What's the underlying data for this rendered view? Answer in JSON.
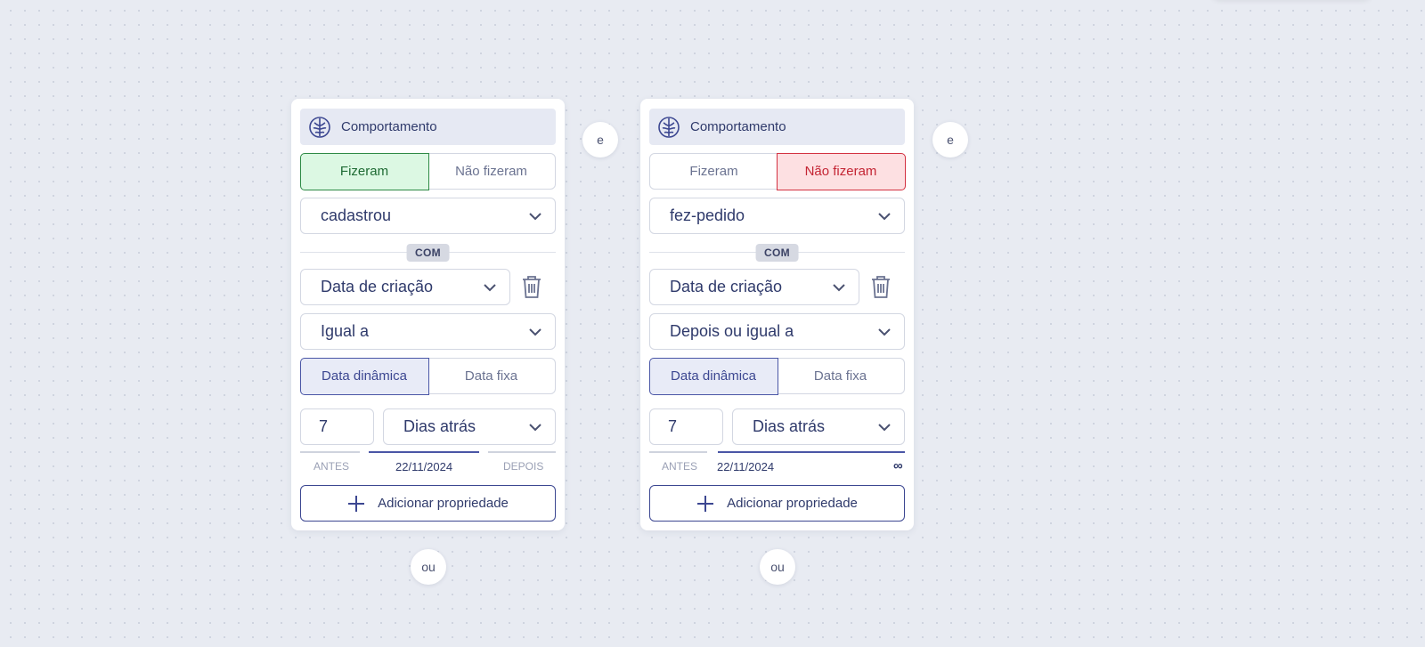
{
  "connectors": {
    "and_label": "e",
    "or_label": "ou"
  },
  "cards": [
    {
      "header_title": "Comportamento",
      "header_icon": "brain-icon",
      "did_options": [
        "Fizeram",
        "Não fizeram"
      ],
      "did_selected": "Fizeram",
      "event": "cadastrou",
      "with_label": "COM",
      "property": "Data de criação",
      "operator": "Igual a",
      "date_mode_options": [
        "Data dinâmica",
        "Data fixa"
      ],
      "date_mode_selected": "Data dinâmica",
      "amount": "7",
      "unit": "Dias atrás",
      "range_before": "ANTES",
      "range_date": "22/11/2024",
      "range_after": "DEPOIS",
      "add_property_label": "Adicionar propriedade"
    },
    {
      "header_title": "Comportamento",
      "header_icon": "brain-icon",
      "did_options": [
        "Fizeram",
        "Não fizeram"
      ],
      "did_selected": "Não fizeram",
      "event": "fez-pedido",
      "with_label": "COM",
      "property": "Data de criação",
      "operator": "Depois ou igual a",
      "date_mode_options": [
        "Data dinâmica",
        "Data fixa"
      ],
      "date_mode_selected": "Data dinâmica",
      "amount": "7",
      "unit": "Dias atrás",
      "range_before": "ANTES",
      "range_date": "22/11/2024",
      "range_after": "∞",
      "add_property_label": "Adicionar propriedade"
    }
  ],
  "colors": {
    "accent": "#3c4791",
    "did_green": "#2d8a45",
    "did_not_red": "#d33141",
    "background": "#e8ebf2"
  }
}
